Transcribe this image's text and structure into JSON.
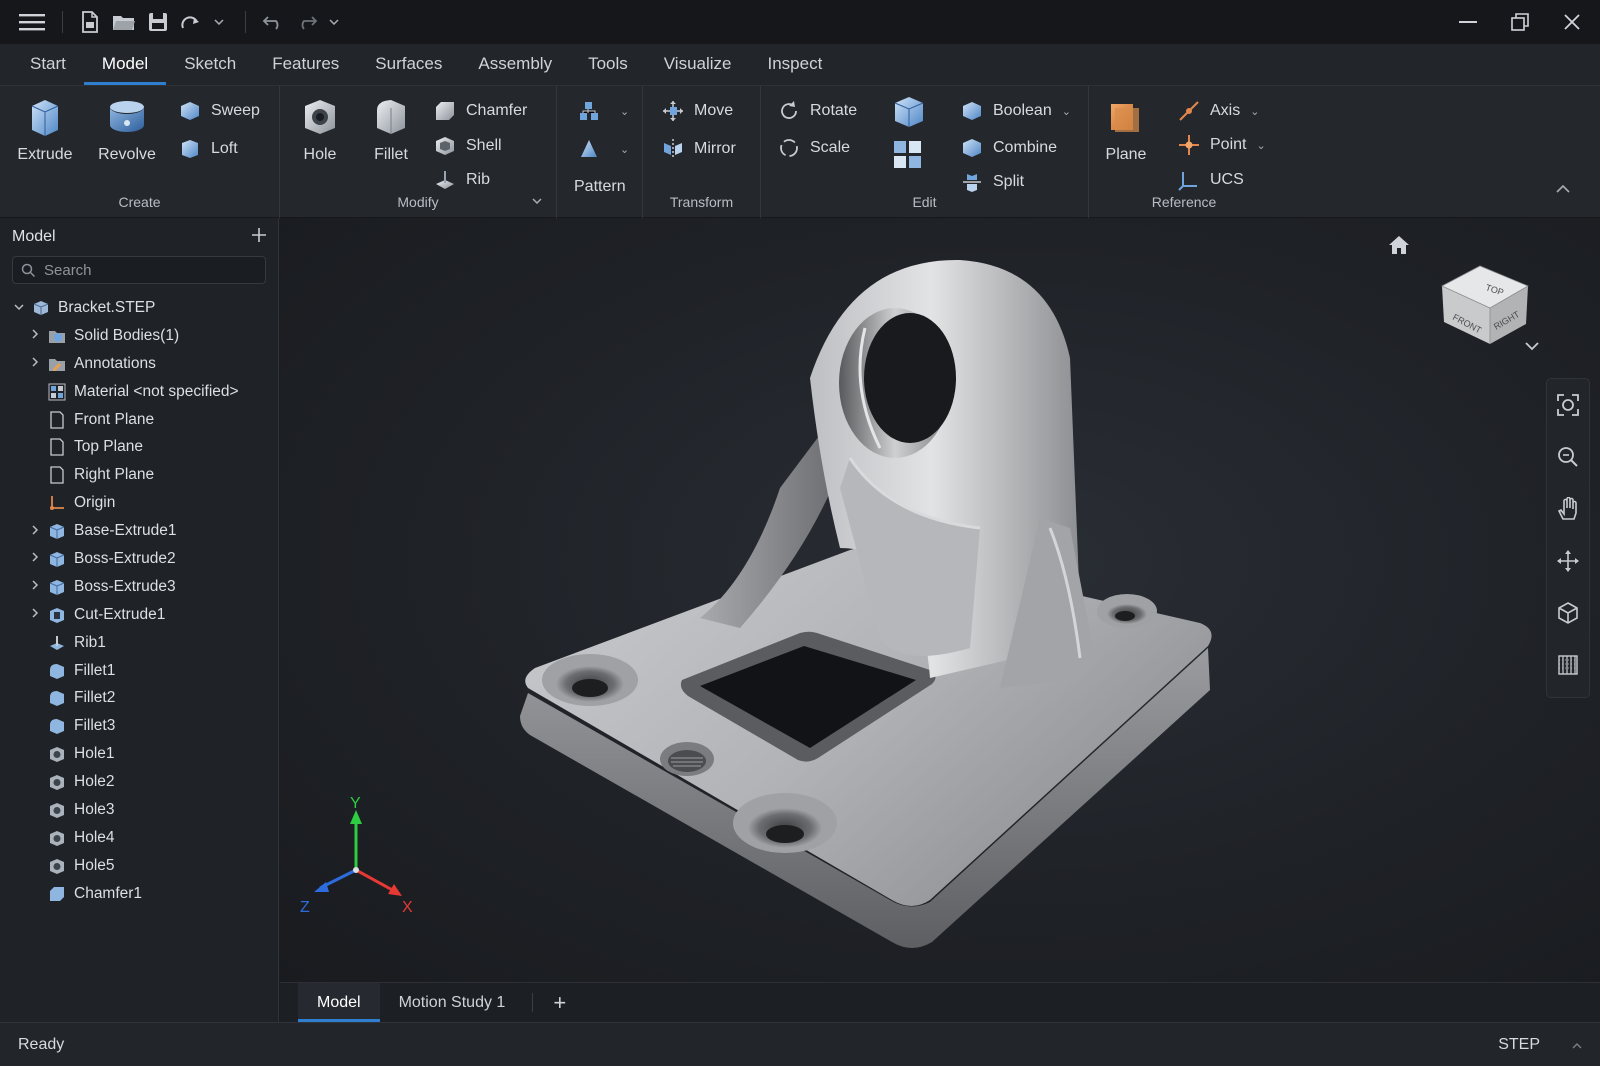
{
  "titlebar": {
    "icons": [
      "menu-icon",
      "new-file-icon",
      "open-folder-icon",
      "save-icon",
      "redo-shape-icon",
      "undo-icon",
      "redo-icon"
    ]
  },
  "menu": {
    "tabs": [
      "Start",
      "Model",
      "Sketch",
      "Features",
      "Surfaces",
      "Assembly",
      "Tools",
      "Visualize",
      "Inspect"
    ],
    "active": "Model"
  },
  "ribbon": {
    "create": {
      "label": "Create",
      "extrude": "Extrude",
      "revolve": "Revolve",
      "sweep": "Sweep",
      "loft": "Loft"
    },
    "modify": {
      "label": "Modify",
      "hole": "Hole",
      "fillet": "Fillet",
      "chamfer": "Chamfer",
      "shell": "Shell",
      "rib": "Rib"
    },
    "pattern": {
      "label": "Pattern"
    },
    "transform": {
      "label": "Transform",
      "move": "Move",
      "mirror": "Mirror"
    },
    "edit": {
      "label": "Edit",
      "rotate": "Rotate",
      "scale": "Scale",
      "boolean": "Boolean",
      "combine": "Combine",
      "split": "Split"
    },
    "reference": {
      "label": "Reference",
      "plane": "Plane",
      "axis": "Axis",
      "point": "Point",
      "ucs": "UCS"
    }
  },
  "panel": {
    "title": "Model",
    "search_placeholder": "Search",
    "tree": [
      {
        "label": "Bracket.STEP",
        "icon": "part-icon",
        "expanded": true,
        "level": 0
      },
      {
        "label": "Solid Bodies(1)",
        "icon": "folder-bodies-icon",
        "expandable": true,
        "level": 1
      },
      {
        "label": "Annotations",
        "icon": "folder-annotations-icon",
        "expandable": true,
        "level": 1
      },
      {
        "label": "Material <not specified>",
        "icon": "material-icon",
        "level": 1
      },
      {
        "label": "Front Plane",
        "icon": "plane-icon",
        "level": 1
      },
      {
        "label": "Top Plane",
        "icon": "plane-icon",
        "level": 1
      },
      {
        "label": "Right Plane",
        "icon": "plane-icon",
        "level": 1
      },
      {
        "label": "Origin",
        "icon": "origin-icon",
        "level": 1
      },
      {
        "label": "Base-Extrude1",
        "icon": "extrude-icon",
        "expandable": true,
        "level": 1
      },
      {
        "label": "Boss-Extrude2",
        "icon": "extrude-icon",
        "expandable": true,
        "level": 1
      },
      {
        "label": "Boss-Extrude3",
        "icon": "extrude-icon",
        "expandable": true,
        "level": 1
      },
      {
        "label": "Cut-Extrude1",
        "icon": "cut-extrude-icon",
        "expandable": true,
        "level": 1
      },
      {
        "label": "Rib1",
        "icon": "rib-icon",
        "level": 1
      },
      {
        "label": "Fillet1",
        "icon": "fillet-icon",
        "level": 1
      },
      {
        "label": "Fillet2",
        "icon": "fillet-icon",
        "level": 1
      },
      {
        "label": "Fillet3",
        "icon": "fillet-icon",
        "level": 1
      },
      {
        "label": "Hole1",
        "icon": "hole-icon",
        "level": 1
      },
      {
        "label": "Hole2",
        "icon": "hole-icon",
        "level": 1
      },
      {
        "label": "Hole3",
        "icon": "hole-icon",
        "level": 1
      },
      {
        "label": "Hole4",
        "icon": "hole-icon",
        "level": 1
      },
      {
        "label": "Hole5",
        "icon": "hole-icon",
        "level": 1
      },
      {
        "label": "Chamfer1",
        "icon": "chamfer-icon",
        "level": 1
      }
    ]
  },
  "viewcube": {
    "top": "TOP",
    "front": "FRONT",
    "right": "RIGHT"
  },
  "triad": {
    "x": "X",
    "y": "Y",
    "z": "Z"
  },
  "doc_tabs": [
    "Model",
    "Motion Study 1"
  ],
  "doc_tab_add": "+",
  "status": {
    "left": "Ready",
    "right": "STEP"
  },
  "colors": {
    "accent": "#2f7fd1",
    "axis_x": "#e53935",
    "axis_y": "#2ecc40",
    "axis_z": "#2d6cdf"
  }
}
